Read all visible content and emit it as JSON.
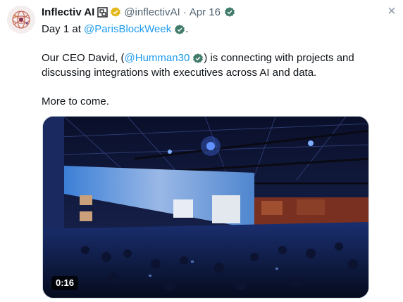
{
  "tweet": {
    "author_name": "Inflectiv AI",
    "handle": "@inflectivAI",
    "separator": "·",
    "date": "Apr 16",
    "line1_text": "Day 1 at",
    "line1_mention": "@ParisBlockWeek",
    "line1_end": ".",
    "line2_text_a": "Our CEO David, (",
    "line2_mention": "@Humman30",
    "line2_text_b": ") is connecting with projects and",
    "line3_text": "discussing integrations with executives across AI and data.",
    "line4_text": "More to come.",
    "video_duration": "0:16",
    "close_glyph": "×"
  },
  "icons": {
    "affiliation": "affiliation-icon",
    "verified": "gold-verified-icon",
    "mention_badge": "gray-verified-icon",
    "close": "close-icon"
  },
  "colors": {
    "text": "#0f1419",
    "secondary": "#536471",
    "link": "#1d9bf0",
    "gold": "#e2b719",
    "gray_badge": "#829aab"
  }
}
